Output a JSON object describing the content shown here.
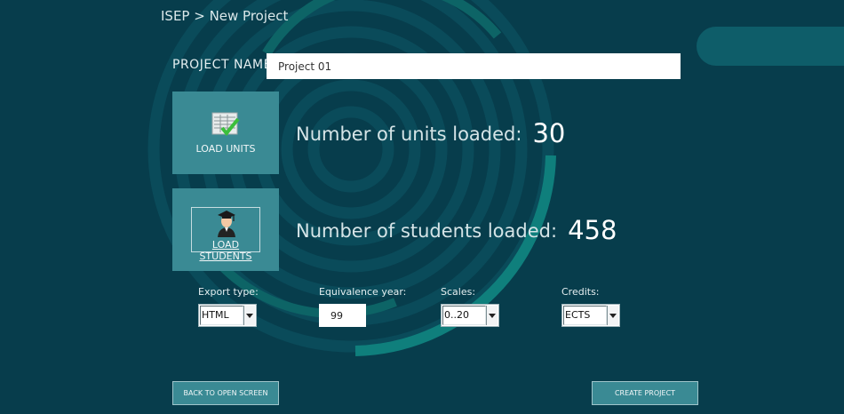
{
  "breadcrumb": "ISEP > New Project",
  "project": {
    "label": "PROJECT NAME:",
    "value": "Project 01"
  },
  "units": {
    "button_label": "LOAD UNITS",
    "stat_label": "Number of units loaded:",
    "count": "30"
  },
  "students": {
    "button_label": "LOAD STUDENTS",
    "stat_label": "Number of students loaded:",
    "count": "458"
  },
  "export_type": {
    "label": "Export type:",
    "value": "HTML"
  },
  "equivalence_year": {
    "label": "Equivalence year:",
    "value": "99"
  },
  "scales": {
    "label": "Scales:",
    "value": "0..20"
  },
  "credits": {
    "label": "Credits:",
    "value": "ECTS"
  },
  "buttons": {
    "back": "BACK TO OPEN SCREEN",
    "create": "CREATE PROJECT"
  },
  "colors": {
    "background": "#073d4c",
    "tile": "#3a8a94",
    "ring_accent": "#0f7f7c"
  }
}
